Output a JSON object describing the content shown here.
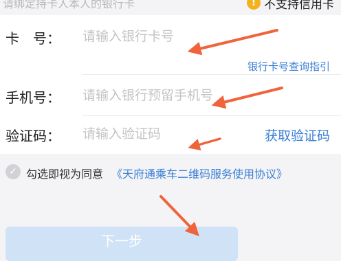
{
  "top": {
    "hint": "请绑定持卡人本人的银行卡",
    "notice": "不支持信用卡",
    "notice_icon": "!"
  },
  "form": {
    "card": {
      "label": "卡　号：",
      "placeholder": "请输入银行卡号",
      "help_link": "银行卡号查询指引"
    },
    "phone": {
      "label": "手机号：",
      "placeholder": "请输入银行预留手机号"
    },
    "code": {
      "label": "验证码：",
      "placeholder": "请输入验证码",
      "get_code": "获取验证码"
    }
  },
  "agreement": {
    "checkmark": "✓",
    "text": "勾选即视为同意",
    "link": "《天府通乘车二维码服务使用协议》"
  },
  "next_button": "下一步",
  "colors": {
    "link": "#3a7fd5",
    "annotation_arrow": "#f0643c",
    "warning": "#f3b21c",
    "button_disabled": "#cfe2f6"
  }
}
